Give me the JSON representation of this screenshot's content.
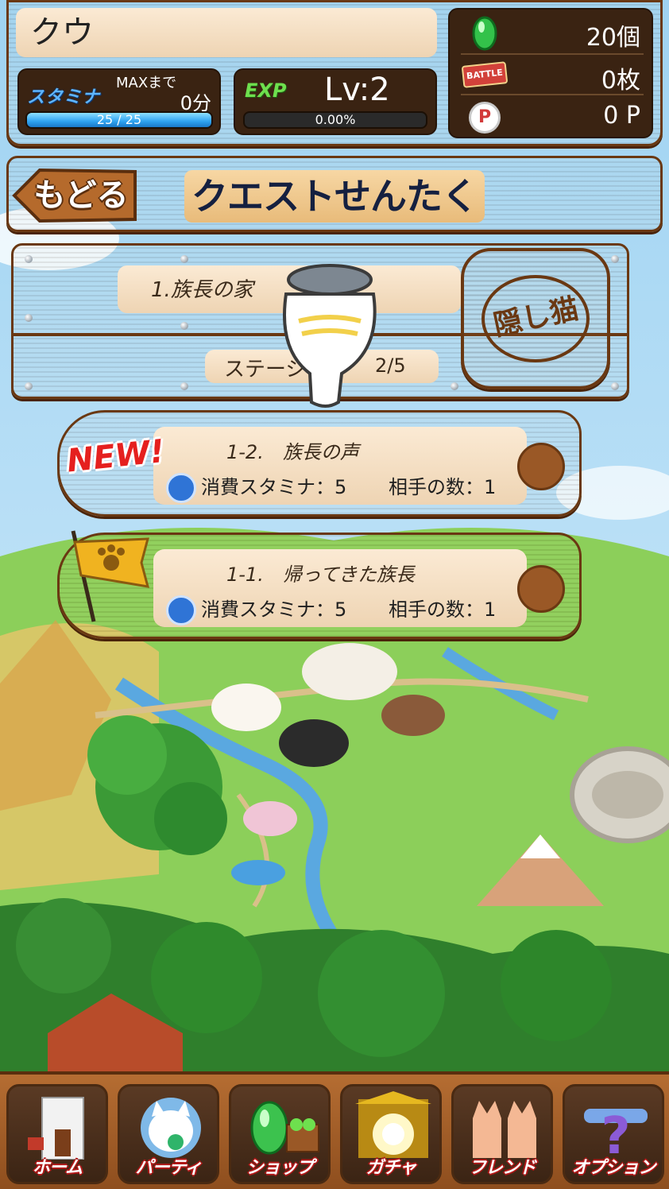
{
  "header": {
    "player_name": "クウ",
    "stamina": {
      "label": "スタミナ",
      "max_until_label": "MAXまで",
      "max_until_value": "0分",
      "bar_text": "25 / 25",
      "fill_fraction": 1.0
    },
    "exp": {
      "label": "EXP",
      "level": "Lv:2",
      "bar_text": "0.00%",
      "fill_fraction": 0.0
    },
    "resources": {
      "gems": "20個",
      "battle_icon_text": "BATTLE",
      "battle_tickets": "0枚",
      "points_icon_text": "P",
      "points": "0 P"
    }
  },
  "title_bar": {
    "back_label": "もどる",
    "title": "クエストせんたく"
  },
  "area": {
    "name": "1.族長の家",
    "stage_label": "ステージ",
    "stage_progress": "2/5",
    "badge_text": "隠し猫"
  },
  "quests": [
    {
      "badge": "NEW!",
      "title": "1-2.　族長の声",
      "stamina_text": "消費スタミナ：5",
      "enemies_text": "相手の数：1"
    },
    {
      "badge": "",
      "title": "1-1.　帰ってきた族長",
      "stamina_text": "消費スタミナ：5",
      "enemies_text": "相手の数：1"
    }
  ],
  "nav": [
    {
      "label": "ホーム",
      "icon": "home-house-icon"
    },
    {
      "label": "パーティ",
      "icon": "party-cat-icon"
    },
    {
      "label": "ショップ",
      "icon": "shop-gem-icon"
    },
    {
      "label": "ガチャ",
      "icon": "gacha-shrine-icon"
    },
    {
      "label": "フレンド",
      "icon": "friends-cats-icon"
    },
    {
      "label": "オプション",
      "icon": "option-question-icon"
    }
  ],
  "colors": {
    "wood": "#a8622a",
    "wood_dark": "#6a3812",
    "plate": "#fbead4",
    "title_text": "#152040",
    "stamina_bar": "#2ea2f0",
    "nav_label_outline": "#b01818"
  }
}
